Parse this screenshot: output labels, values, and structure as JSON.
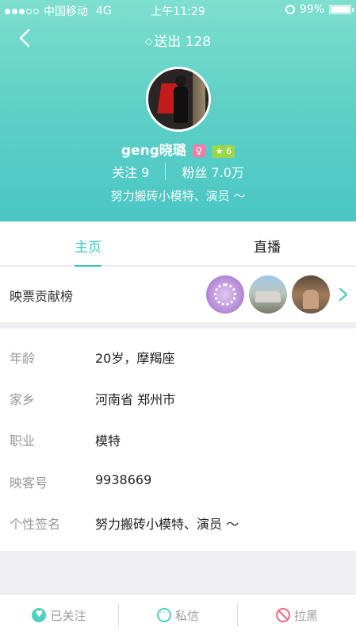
{
  "status_bar": {
    "carrier": "中国移动",
    "network": "4G",
    "time": "上午11:29",
    "battery": "99%",
    "battery_level": 0.99
  },
  "header": {
    "sent_label": "送出 128",
    "username": "geng晓璐",
    "gender_symbol": "♀",
    "level": "6",
    "following_label": "关注 9",
    "fans_label": "粉丝 7.0万",
    "bio": "努力搬砖小模特、演员 ～"
  },
  "tabs": [
    {
      "label": "主页",
      "active": true
    },
    {
      "label": "直播",
      "active": false
    }
  ],
  "ranking": {
    "label": "映票贡献榜"
  },
  "info": [
    {
      "key": "年龄",
      "value": "20岁，摩羯座"
    },
    {
      "key": "家乡",
      "value": "河南省 郑州市"
    },
    {
      "key": "职业",
      "value": "模特"
    },
    {
      "key": "映客号",
      "value": "9938669"
    },
    {
      "key": "个性签名",
      "value": "努力搬砖小模特、演员 ～"
    }
  ],
  "actions": {
    "followed": "已关注",
    "message": "私信",
    "block": "拉黑"
  },
  "colors": {
    "accent": "#36c6b8",
    "block_red": "#f06a7a"
  }
}
